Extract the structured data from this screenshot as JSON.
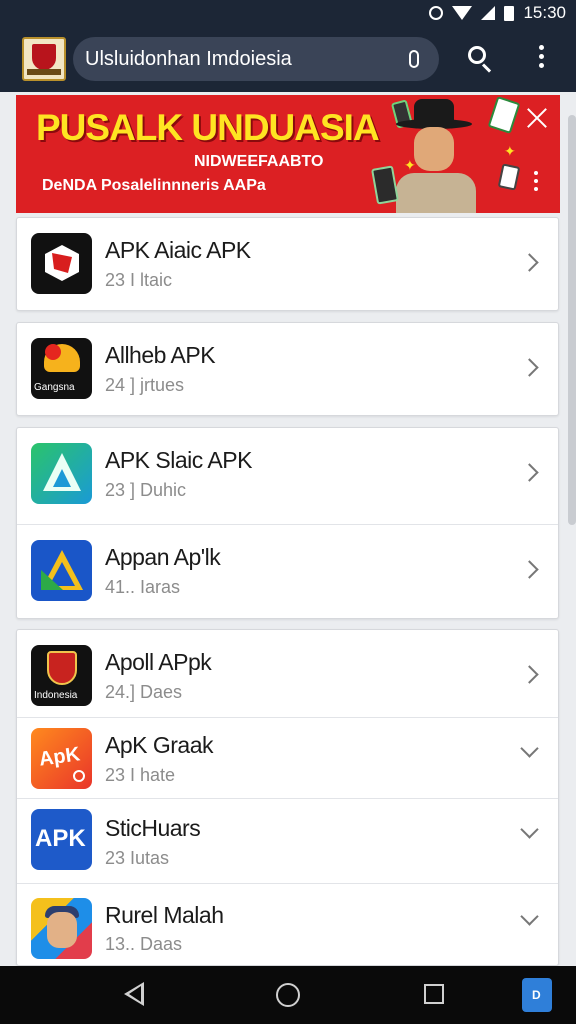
{
  "status_bar": {
    "time": "15:30"
  },
  "toolbar": {
    "search_text": "Ulsluidonhan Imdoiesia"
  },
  "banner": {
    "title": "PUSALK UNDUASIA",
    "subtitle": "NIDWEEFAABTO",
    "tagline": "DeNDA Posalelinnneris AAPa"
  },
  "apps": [
    {
      "name": "APK Aiaic APK",
      "meta": "23 I ltaic",
      "icon": "black-hexagon-icon",
      "chevron": "right"
    },
    {
      "name": "Allheb APK",
      "meta": "24 ] jrtues",
      "icon": "heart-logo-icon",
      "icon_label": "Gangsna",
      "chevron": "right"
    },
    {
      "name": "APK Slaic APK",
      "meta": "23 ] Duhic",
      "icon": "green-triangle-icon",
      "chevron": "right"
    },
    {
      "name": "Appan Ap'lk",
      "meta": "41.. Iaras",
      "icon": "blue-triangle-icon",
      "chevron": "right"
    },
    {
      "name": "Apoll APpk",
      "meta": "24.] Daes",
      "icon": "emblem-icon",
      "icon_label": "Indonesia",
      "chevron": "right"
    },
    {
      "name": "ApK Graak",
      "meta": "23 I hate",
      "icon": "orange-apk-icon",
      "icon_label": "ApK",
      "chevron": "down"
    },
    {
      "name": "SticHuars",
      "meta": "23 Iutas",
      "icon": "apk-icon",
      "icon_label": "APK",
      "chevron": "down"
    },
    {
      "name": "Rurel Malah",
      "meta": "13.. Daas",
      "icon": "person-icon",
      "chevron": "down"
    }
  ],
  "nav": {
    "store_label": "D"
  },
  "colors": {
    "toolbar": "#1c2636",
    "banner": "#dc2023",
    "banner_title": "#ffe422"
  }
}
